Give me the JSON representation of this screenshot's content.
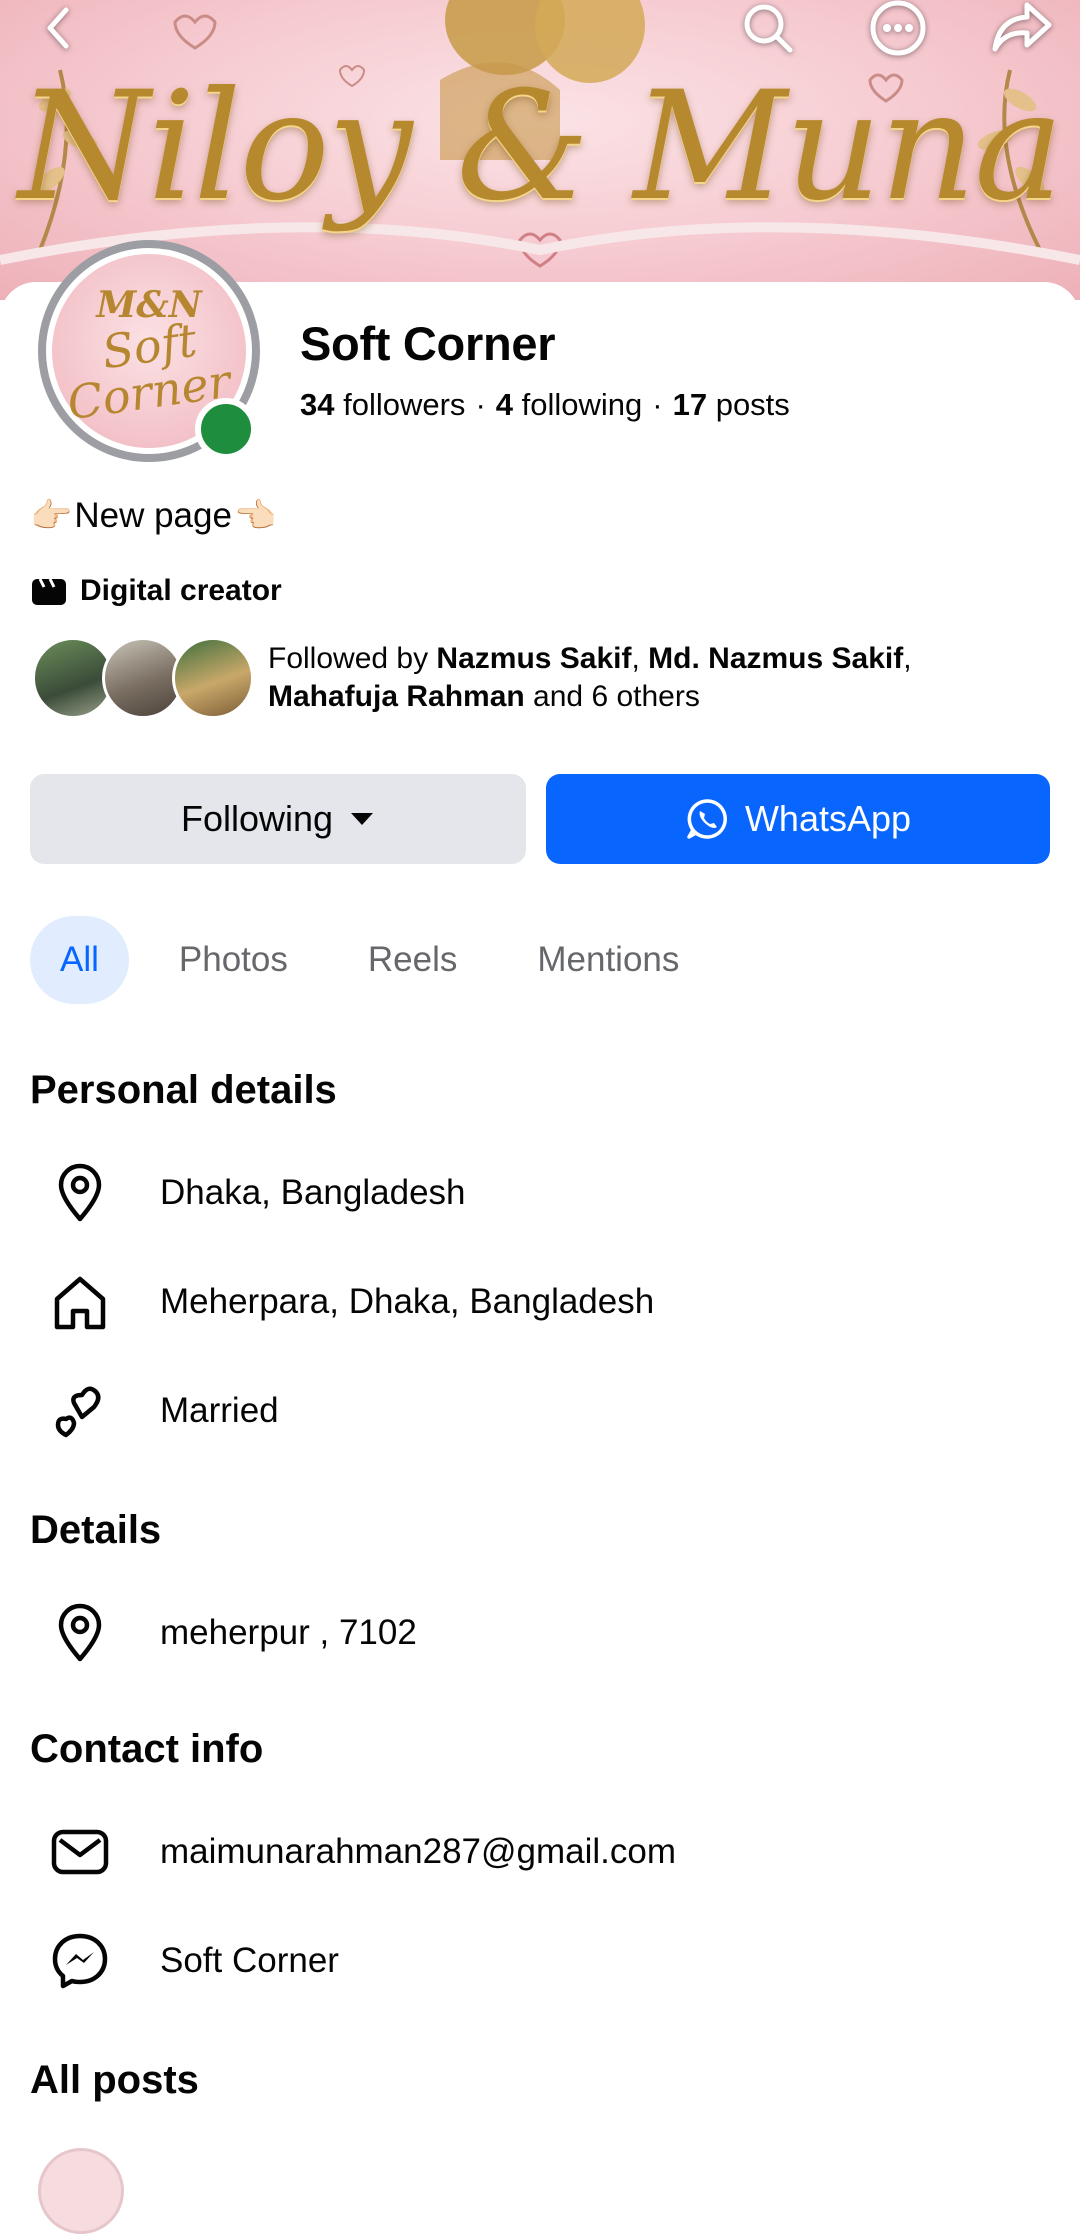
{
  "cover": {
    "title": "Niloy & Muna"
  },
  "avatar": {
    "monogram": "M&N",
    "script_line1": "Soft",
    "script_line2": "Corner"
  },
  "profile": {
    "name": "Soft Corner",
    "followers_count": "34",
    "followers_label": "followers",
    "following_count": "4",
    "following_label": "following",
    "posts_count": "17",
    "posts_label": "posts",
    "separator": "·",
    "bio": "New page",
    "category": "Digital creator"
  },
  "followed_by": {
    "prefix": "Followed by ",
    "name1": "Nazmus Sakif",
    "comma": ", ",
    "name2": "Md. Nazmus Sakif",
    "name3": "Mahafuja Rahman",
    "suffix": " and 6 others"
  },
  "actions": {
    "following_label": "Following",
    "whatsapp_label": "WhatsApp"
  },
  "tabs": [
    {
      "label": "All"
    },
    {
      "label": "Photos"
    },
    {
      "label": "Reels"
    },
    {
      "label": "Mentions"
    }
  ],
  "personal_details": {
    "title": "Personal details",
    "location": "Dhaka, Bangladesh",
    "hometown": "Meherpara, Dhaka, Bangladesh",
    "relationship": "Married"
  },
  "details": {
    "title": "Details",
    "address": "meherpur , 7102"
  },
  "contact": {
    "title": "Contact info",
    "email": "maimunarahman287@gmail.com",
    "messenger": "Soft Corner"
  },
  "all_posts": {
    "title": "All posts"
  },
  "colors": {
    "accent": "#0866ff",
    "online": "#1e8e3e",
    "button_gray": "#e4e6eb",
    "tab_active_bg": "#e1edfe"
  }
}
